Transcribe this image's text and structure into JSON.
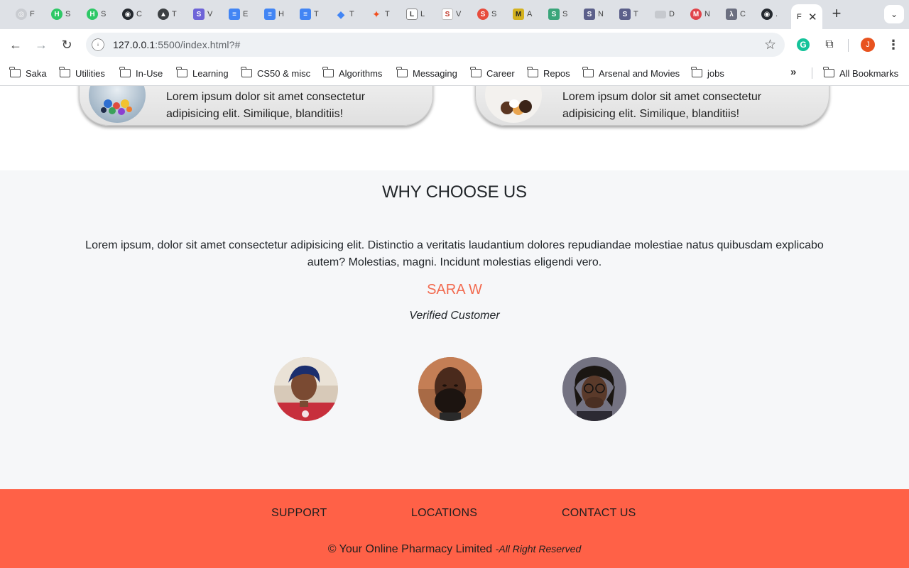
{
  "browser": {
    "tabs": [
      {
        "icon": "openai-icon",
        "label": "F",
        "color": "#9aa0a6"
      },
      {
        "icon": "hackerrank-icon",
        "label": "S",
        "color": "#2ec866"
      },
      {
        "icon": "hackerrank-icon",
        "label": "S",
        "color": "#2ec866"
      },
      {
        "icon": "github-icon",
        "label": "C",
        "color": "#24292f"
      },
      {
        "icon": "triangle-icon",
        "label": "T",
        "color": "#3c4043"
      },
      {
        "icon": "s-icon",
        "label": "V",
        "color": "#6e64d8"
      },
      {
        "icon": "docs-icon",
        "label": "E",
        "color": "#4285f4"
      },
      {
        "icon": "docs-icon",
        "label": "H",
        "color": "#4285f4"
      },
      {
        "icon": "docs-icon",
        "label": "T",
        "color": "#4285f4"
      },
      {
        "icon": "diamond-icon",
        "label": "T",
        "color": "#4285f4"
      },
      {
        "icon": "figma-icon",
        "label": "T",
        "color": "#f24e1e"
      },
      {
        "icon": "l-icon",
        "label": "L",
        "color": "#6b6b6b"
      },
      {
        "icon": "s-icon",
        "label": "V",
        "color": "#c0392b"
      },
      {
        "icon": "s-icon",
        "label": "S",
        "color": "#e74c3c"
      },
      {
        "icon": "m-icon",
        "label": "A",
        "color": "#d4b21f"
      },
      {
        "icon": "s-icon",
        "label": "S",
        "color": "#3aa57a"
      },
      {
        "icon": "s-icon",
        "label": "N",
        "color": "#5b5f8a"
      },
      {
        "icon": "s-icon",
        "label": "T",
        "color": "#5b5f8a"
      },
      {
        "icon": "card-icon",
        "label": "D",
        "color": "#c6c9ce"
      },
      {
        "icon": "m-icon",
        "label": "N",
        "color": "#e0444a"
      },
      {
        "icon": "lambda-icon",
        "label": "C",
        "color": "#6b6f80"
      },
      {
        "icon": "github-icon",
        "label": ".",
        "color": "#24292f"
      },
      {
        "icon": "page-icon",
        "label": "F",
        "color": "#fff"
      }
    ],
    "active_tab_close": "✕",
    "new_tab": "+",
    "url_host": "127.0.0.1",
    "url_rest": ":5500/index.html?#",
    "profile_initial": "J",
    "bookmarks": [
      "Saka",
      "Utilities",
      "In-Use",
      "Learning",
      "CS50 & misc",
      "Algorithms",
      "Messaging",
      "Career",
      "Repos",
      "Arsenal and Movies",
      "jobs"
    ],
    "bookmarks_overflow": "»",
    "all_bookmarks": "All Bookmarks"
  },
  "services": {
    "cards": [
      {
        "text": "Lorem ipsum dolor sit amet consectetur adipisicing elit. Similique, blanditiis!"
      },
      {
        "text": "Lorem ipsum dolor sit amet consectetur adipisicing elit. Similique, blanditiis!"
      }
    ]
  },
  "why": {
    "title": "WHY CHOOSE US",
    "testimonial": "Lorem ipsum, dolor sit amet consectetur adipisicing elit. Distinctio a veritatis laudantium dolores repudiandae molestiae natus quibusdam explicabo autem? Molestias, magni. Incidunt molestias eligendi vero.",
    "customer_name": "SARA W",
    "customer_role": "Verified Customer"
  },
  "footer": {
    "links": [
      "SUPPORT",
      "LOCATIONS",
      "CONTACT US"
    ],
    "copyright": "© Your Online Pharmacy Limited",
    "rights": "-All Right Reserved"
  },
  "colors": {
    "accent": "#ff6147",
    "customer_name": "#f26a4f"
  }
}
